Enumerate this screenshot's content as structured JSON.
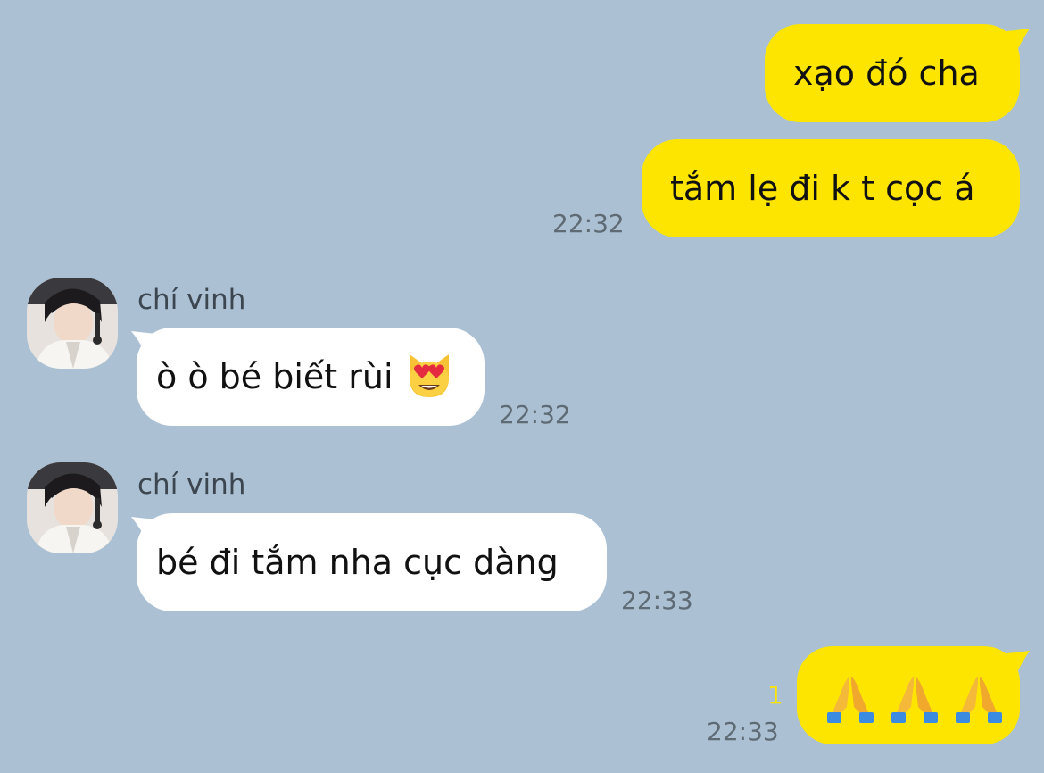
{
  "messages": [
    {
      "from": "me",
      "text": "xạo đó cha"
    },
    {
      "from": "me",
      "text": "tắm lẹ đi k t cọc á",
      "time": "22:32"
    },
    {
      "from": "them",
      "sender": "chí vinh",
      "text": "ò ò bé biết rùi",
      "emoji": "heart-eyes-cat-emoji",
      "time": "22:32"
    },
    {
      "from": "them",
      "sender": "chí vinh",
      "text": "bé đi tắm nha cục dàng",
      "time": "22:33"
    },
    {
      "from": "me",
      "emoji": "folded-hands-emoji x3",
      "time": "22:33",
      "unread": "1"
    }
  ],
  "colors": {
    "background": "#abc1d3",
    "my_bubble": "#fee500",
    "their_bubble": "#ffffff",
    "timestamp": "#5e6a74",
    "unread_count": "#fee500"
  }
}
